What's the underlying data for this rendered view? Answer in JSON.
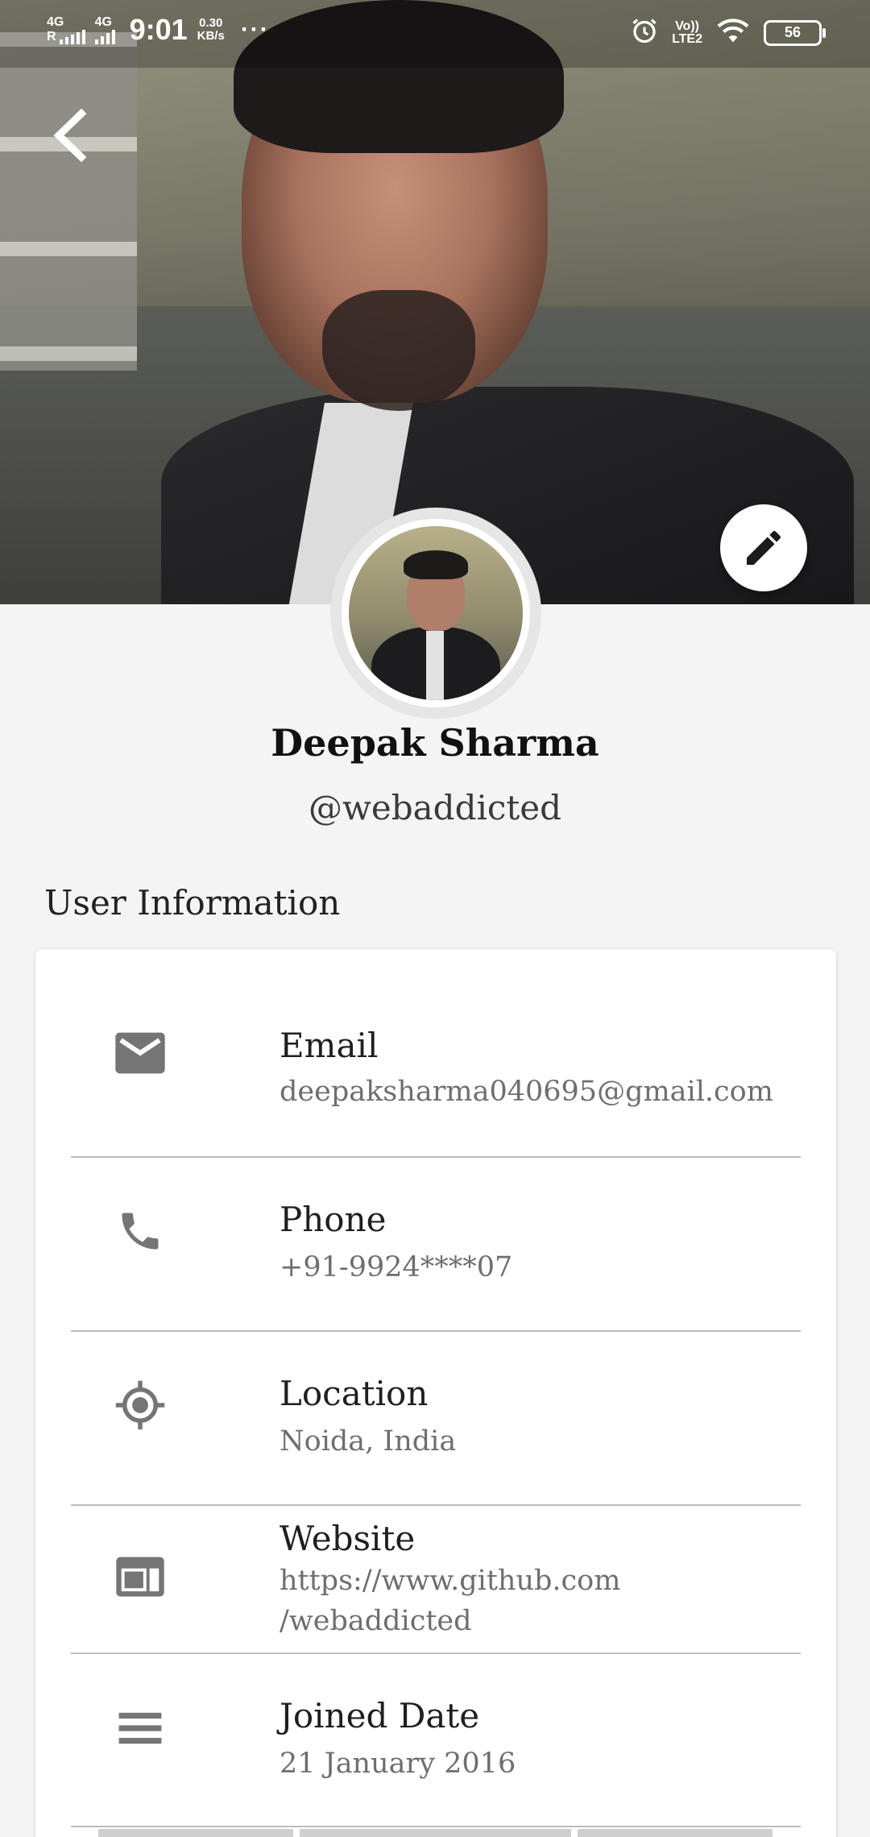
{
  "status_bar": {
    "network1": "4G",
    "network1_sub": "R",
    "network2": "4G",
    "time": "9:01",
    "speed_value": "0.30",
    "speed_unit": "KB/s",
    "more": "···",
    "volte": "Vo))",
    "lte": "LTE2",
    "battery": "56"
  },
  "profile": {
    "name": "Deepak Sharma",
    "handle": "@webaddicted"
  },
  "section_title": "User Information",
  "info": {
    "email": {
      "label": "Email",
      "value": "deepaksharma040695@gmail.com",
      "icon": "mail-icon"
    },
    "phone": {
      "label": "Phone",
      "value": "+91-9924****07",
      "icon": "phone-icon"
    },
    "location": {
      "label": "Location",
      "value": "Noida, India",
      "icon": "location-icon"
    },
    "website": {
      "label": "Website",
      "value_line1": "https://www.github.com",
      "value_line2": "/webaddicted",
      "icon": "web-icon"
    },
    "joined": {
      "label": "Joined Date",
      "value": "21 January 2016",
      "icon": "list-icon"
    }
  },
  "colors": {
    "background": "#f4f4f4",
    "card": "#ffffff",
    "icon_gray": "#757575",
    "divider": "#bdbdbd"
  }
}
